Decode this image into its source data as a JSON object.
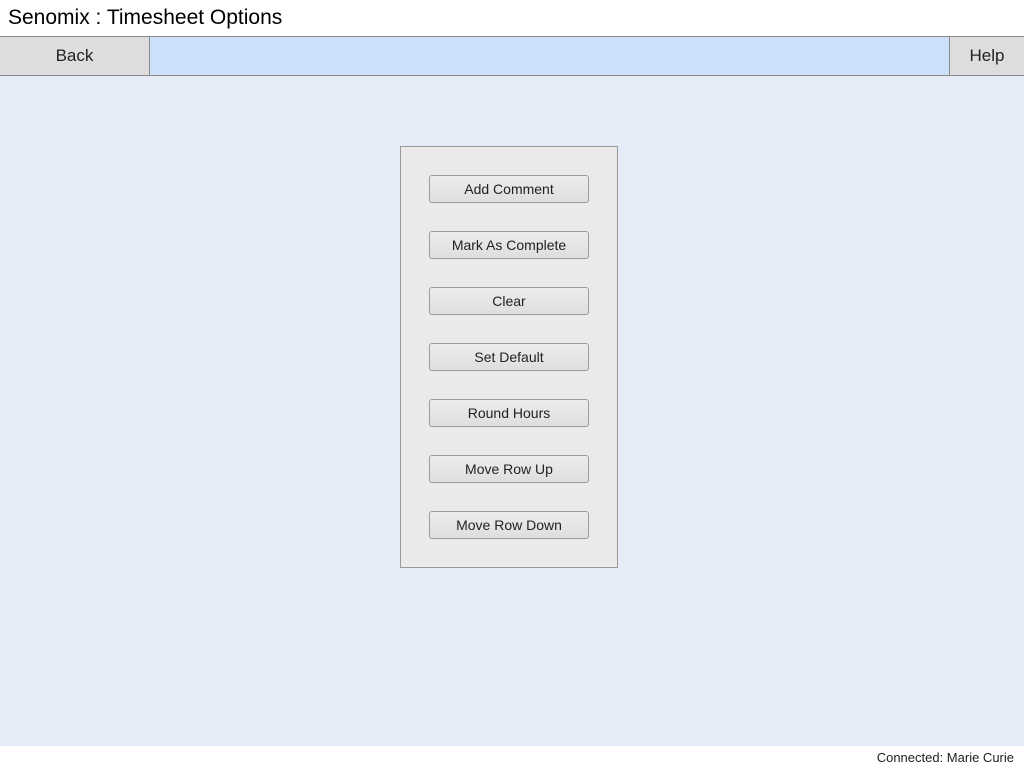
{
  "title": "Senomix : Timesheet Options",
  "toolbar": {
    "back_label": "Back",
    "help_label": "Help"
  },
  "options": {
    "add_comment": "Add Comment",
    "mark_complete": "Mark As Complete",
    "clear": "Clear",
    "set_default": "Set Default",
    "round_hours": "Round Hours",
    "move_row_up": "Move Row Up",
    "move_row_down": "Move Row Down"
  },
  "status": {
    "connected_text": "Connected: Marie Curie"
  }
}
